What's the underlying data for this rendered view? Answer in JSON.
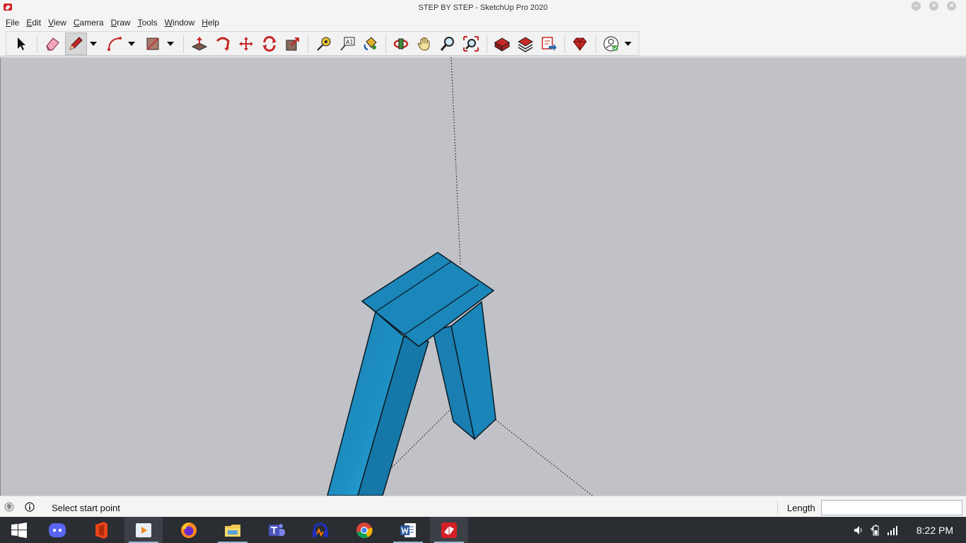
{
  "window": {
    "title": "STEP BY STEP - SketchUp Pro 2020"
  },
  "menu": [
    {
      "key": "F",
      "rest": "ile"
    },
    {
      "key": "E",
      "rest": "dit"
    },
    {
      "key": "V",
      "rest": "iew"
    },
    {
      "key": "C",
      "rest": "amera"
    },
    {
      "key": "D",
      "rest": "raw"
    },
    {
      "key": "T",
      "rest": "ools"
    },
    {
      "key": "W",
      "rest": "indow"
    },
    {
      "key": "H",
      "rest": "elp"
    }
  ],
  "toolbar": {
    "active_tool": "line-tool"
  },
  "statusbar": {
    "message": "Select start point",
    "vcb_label": "Length",
    "vcb_value": ""
  },
  "taskbar": {
    "time": "8:22 PM"
  },
  "colors": {
    "viewport_bg": "#c1c2c7",
    "model_blue": "#1a86b8",
    "taskbar_bg": "#2a2d31"
  }
}
